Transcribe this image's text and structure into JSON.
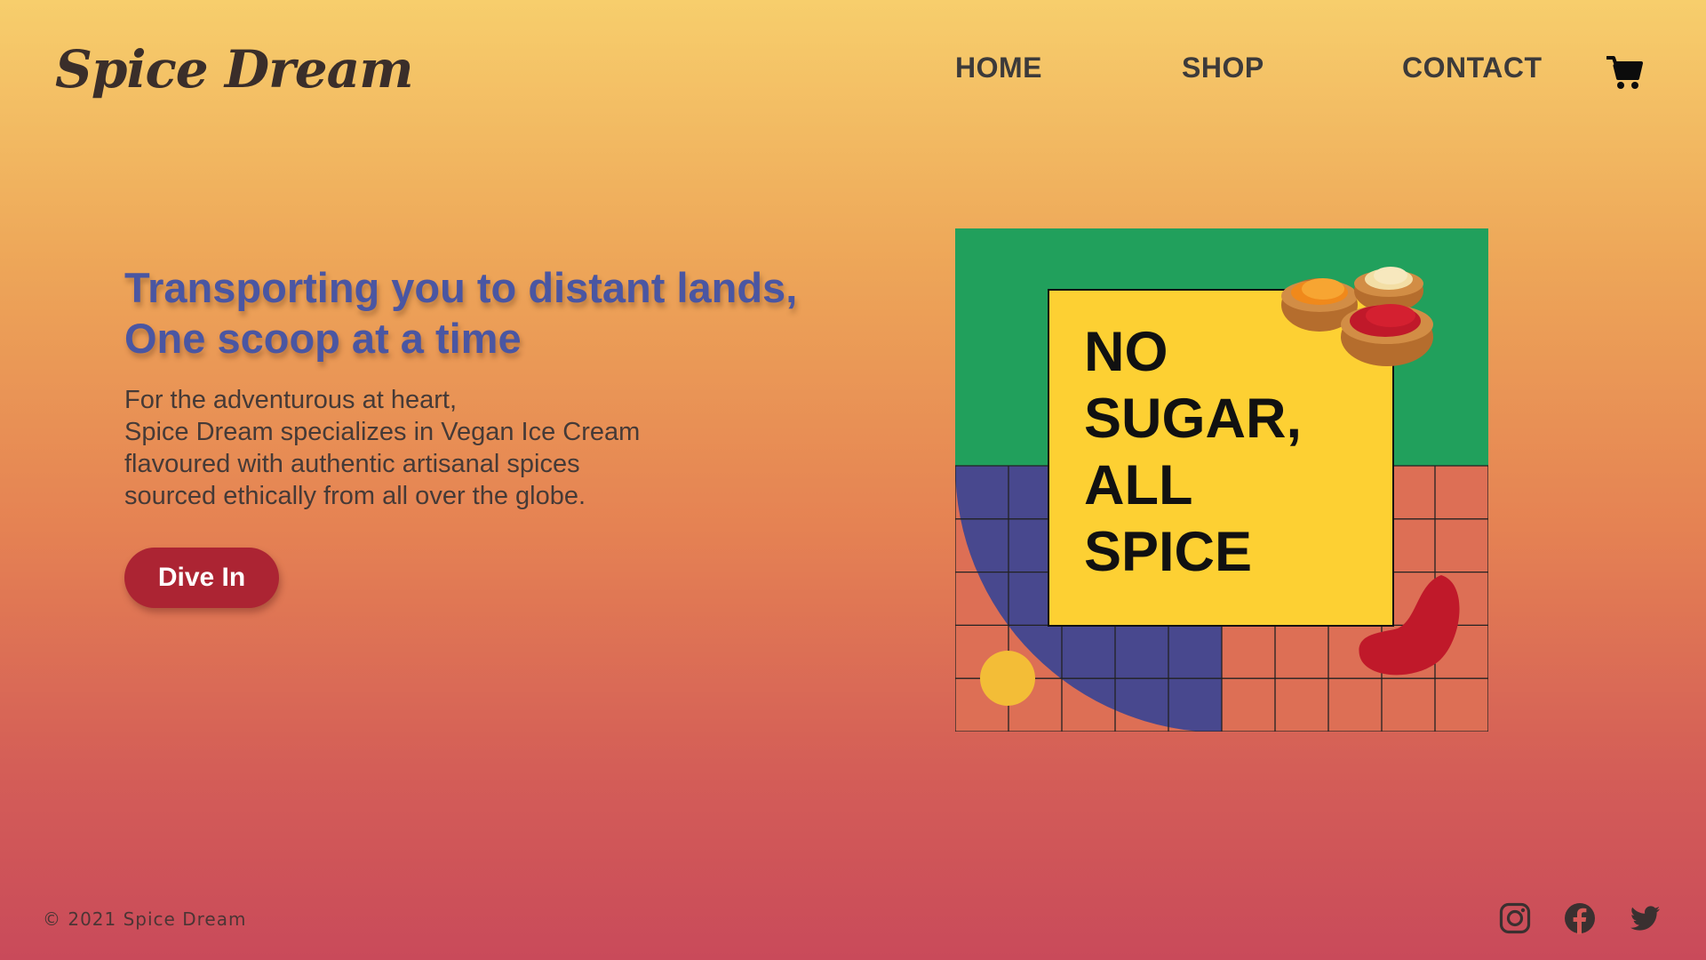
{
  "brand": {
    "name": "Spice Dream"
  },
  "nav": {
    "items": [
      "HOME",
      "SHOP",
      "CONTACT"
    ]
  },
  "hero": {
    "headline_line1": "Transporting you to distant lands,",
    "headline_line2": "One scoop at a time",
    "body_lines": [
      "For the adventurous at heart,",
      "Spice Dream specializes in Vegan Ice Cream",
      "flavoured with authentic artisanal spices",
      "sourced ethically from all over the globe."
    ],
    "cta_label": "Dive In"
  },
  "artwork": {
    "lines": [
      "NO",
      "SUGAR,",
      "ALL",
      "SPICE"
    ]
  },
  "footer": {
    "copyright": "© 2021 Spice Dream",
    "social": [
      "instagram-icon",
      "facebook-icon",
      "twitter-icon"
    ]
  },
  "colors": {
    "headline": "#4a56a2",
    "button": "#ac2433",
    "art_green": "#21a05c",
    "art_yellow": "#fdd033",
    "art_blue": "#48488e",
    "art_red": "#c0192a"
  }
}
